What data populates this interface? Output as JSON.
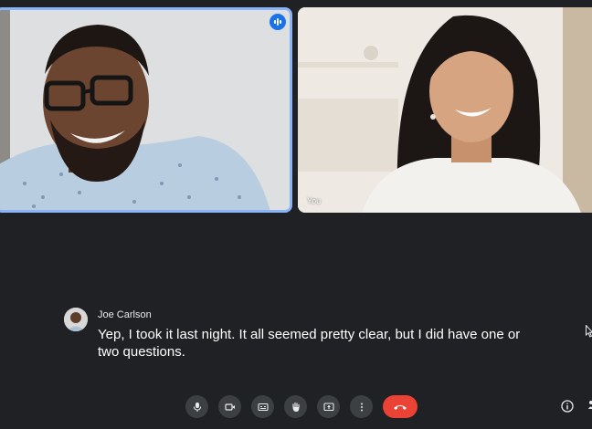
{
  "tiles": [
    {
      "name": "",
      "speaking": true
    },
    {
      "name": "You",
      "speaking": false
    }
  ],
  "caption": {
    "speaker": "Joe Carlson",
    "text": "Yep, I took it last night. It all seemed pretty clear, but I did have one or two questions."
  },
  "controls": [
    "microphone-icon",
    "camera-icon",
    "captions-icon",
    "raise-hand-icon",
    "present-icon",
    "more-options-icon",
    "end-call-icon"
  ],
  "colors": {
    "background": "#202124",
    "button": "#3c4043",
    "hangup": "#ea4335",
    "active_speaker_border": "#8ab4f8",
    "speaking_badge": "#1a73e8"
  }
}
